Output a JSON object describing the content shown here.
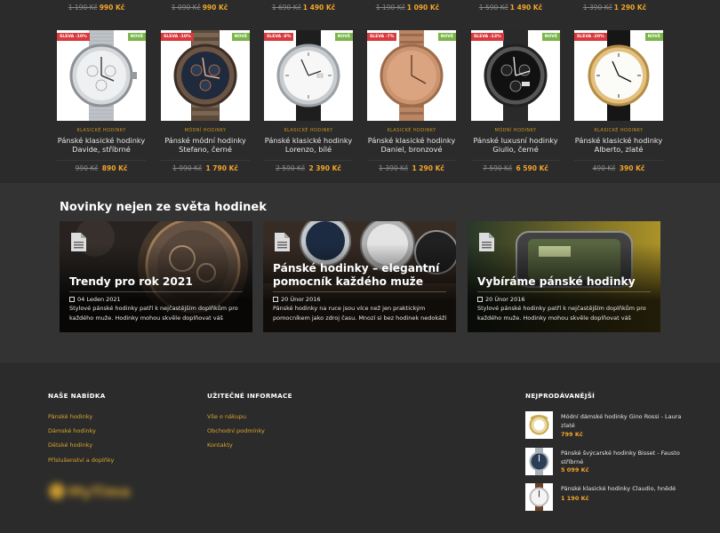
{
  "top_prices": [
    {
      "old": "1 190 Kč",
      "new": "990 Kč"
    },
    {
      "old": "1 090 Kč",
      "new": "990 Kč"
    },
    {
      "old": "1 690 Kč",
      "new": "1 490 Kč"
    },
    {
      "old": "1 190 Kč",
      "new": "1 090 Kč"
    },
    {
      "old": "1 590 Kč",
      "new": "1 490 Kč"
    },
    {
      "old": "1 390 Kč",
      "new": "1 290 Kč"
    }
  ],
  "products": [
    {
      "sale": "SLEVA -10%",
      "new_badge": "NOVÉ",
      "category": "KLASICKÉ HODINKY",
      "name": "Pánské klasické hodinky Davide, stříbrné",
      "old": "990 Kč",
      "new": "890 Kč",
      "watch": "silver-mesh"
    },
    {
      "sale": "SLEVA -10%",
      "new_badge": "NOVÉ",
      "category": "MÓDNÍ HODINKY",
      "name": "Pánské módní hodinky Stefano, černé",
      "old": "1 990 Kč",
      "new": "1 790 Kč",
      "watch": "bronze-chrono"
    },
    {
      "sale": "SLEVA -8%",
      "new_badge": "NOVÉ",
      "category": "KLASICKÉ HODINKY",
      "name": "Pánské klasické hodinky Lorenzo, bílé",
      "old": "2 590 Kč",
      "new": "2 390 Kč",
      "watch": "white-leather"
    },
    {
      "sale": "SLEVA -7%",
      "new_badge": "NOVÉ",
      "category": "KLASICKÉ HODINKY",
      "name": "Pánské klasické hodinky Daniel, bronzové",
      "old": "1 390 Kč",
      "new": "1 290 Kč",
      "watch": "rose-gold"
    },
    {
      "sale": "SLEVA -13%",
      "new_badge": "NOVÉ",
      "category": "MÓDNÍ HODINKY",
      "name": "Pánské luxusní hodinky Giulio, černé",
      "old": "7 590 Kč",
      "new": "6 590 Kč",
      "watch": "black-chrono"
    },
    {
      "sale": "SLEVA -20%",
      "new_badge": "NOVÉ",
      "category": "KLASICKÉ HODINKY",
      "name": "Pánské klasické hodinky Alberto, zlaté",
      "old": "490 Kč",
      "new": "390 Kč",
      "watch": "gold-white"
    }
  ],
  "news": {
    "title": "Novinky nejen ze světa hodinek",
    "posts": [
      {
        "title": "Trendy pro rok 2021",
        "date": "04 Leden 2021",
        "excerpt": "Stylové pánské hodinky patří k nejčastějším doplňkům pro každého muže. Hodinky mohou skvěle doplňovat váš"
      },
      {
        "title": "Pánské hodinky – elegantní pomocník každého muže",
        "date": "20 Únor 2016",
        "excerpt": "Pánské hodinky na ruce jsou více než jen praktickým pomocníkem jako zdroj času. Mnozí si bez hodinek nedokáží"
      },
      {
        "title": "Vybíráme pánské hodinky",
        "date": "20 Únor 2016",
        "excerpt": "Stylové pánské hodinky patří k nejčastějším doplňkům pro každého muže. Hodinky mohou skvěle doplňovat váš"
      }
    ]
  },
  "footer": {
    "offer_title": "NAŠE NABÍDKA",
    "offer_links": [
      "Pánské hodinky",
      "Dámské hodinky",
      "Dětské hodinky",
      "Příslušenství a doplňky"
    ],
    "info_title": "UŽITEČNÉ INFORMACE",
    "info_links": [
      "Vše o nákupu",
      "Obchodní podmínky",
      "Kontakty"
    ],
    "best_title": "NEJPRODÁVANĚJŠÍ",
    "best": [
      {
        "name": "Módní dámské hodinky Gino Rossi - Laura zlaté",
        "price": "799 Kč"
      },
      {
        "name": "Pánské švýcarské hodinky Bisset - Fausto stříbrné",
        "price": "5 099 Kč"
      },
      {
        "name": "Pánské klasické hodinky Claudio, hnědé",
        "price": "1 190 Kč"
      }
    ],
    "logo_text": "MyTime"
  },
  "colors": {
    "accent": "#f3a52b",
    "sale": "#d9393c",
    "new": "#7bb548",
    "category": "#c9941d"
  }
}
